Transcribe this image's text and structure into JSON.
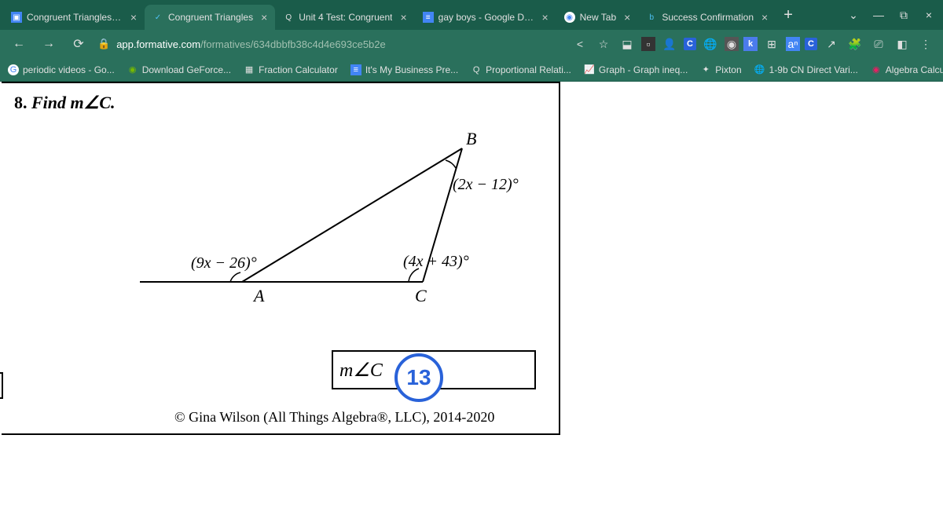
{
  "tabs": [
    {
      "title": "Congruent Triangles TE",
      "active": false
    },
    {
      "title": "Congruent Triangles",
      "active": true
    },
    {
      "title": "Unit 4 Test: Congruent",
      "active": false
    },
    {
      "title": "gay boys - Google Docs",
      "active": false
    },
    {
      "title": "New Tab",
      "active": false
    },
    {
      "title": "Success Confirmation",
      "active": false
    }
  ],
  "url": {
    "icon": "🔒",
    "domain": "app.formative.com",
    "path": "/formatives/634dbbfb38c4d4e693ce5b2e"
  },
  "bookmarks": [
    {
      "label": "periodic videos - Go..."
    },
    {
      "label": "Download GeForce..."
    },
    {
      "label": "Fraction Calculator"
    },
    {
      "label": "It's My Business Pre..."
    },
    {
      "label": "Proportional Relati..."
    },
    {
      "label": "Graph - Graph ineq..."
    },
    {
      "label": "Pixton"
    },
    {
      "label": "1-9b CN Direct Vari..."
    },
    {
      "label": "Algebra Calculator..."
    }
  ],
  "problem": {
    "number": "8.",
    "prompt": "Find m∠C.",
    "vertex_A": "A",
    "vertex_B": "B",
    "vertex_C": "C",
    "angle_exterior_A": "(9x − 26)°",
    "angle_B": "(2x − 12)°",
    "angle_C": "(4x + 43)°",
    "answer_label": "m∠C",
    "badge": "13",
    "copyright": "© Gina Wilson (All Things Algebra®, LLC), 2014-2020"
  }
}
